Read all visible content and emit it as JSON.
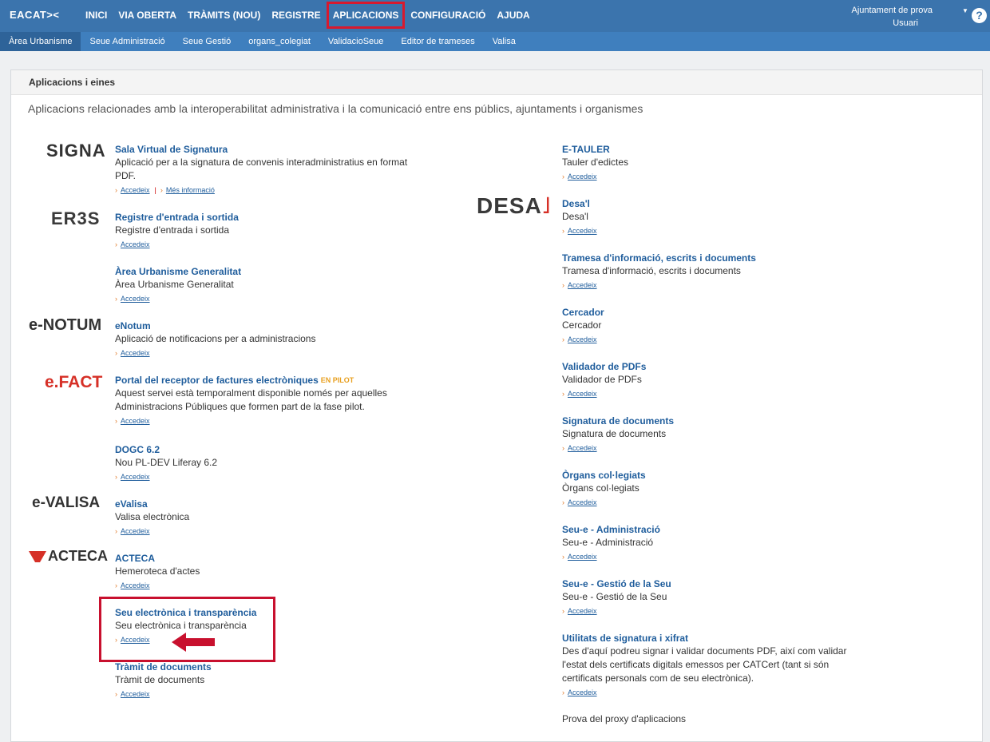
{
  "header": {
    "brand": "EACAT><",
    "nav": [
      "INICI",
      "VIA OBERTA",
      "TRÀMITS (NOU)",
      "REGISTRE",
      "APLICACIONS",
      "CONFIGURACIÓ",
      "AJUDA"
    ],
    "active_nav": "APLICACIONS",
    "org": "Ajuntament de prova",
    "user": "Usuari",
    "help": "?"
  },
  "subnav": [
    "Àrea Urbanisme",
    "Seue Administració",
    "Seue Gestió",
    "organs_colegiat",
    "ValidacioSeue",
    "Editor de trameses",
    "Valisa"
  ],
  "panel": {
    "title": "Aplicacions i eines",
    "intro": "Aplicacions relacionades amb la interoperabilitat administrativa i la comunicació entre ens públics, ajuntaments i organismes"
  },
  "links": {
    "access": "Accedeix",
    "more": "Més informació",
    "pilot": "EN PILOT"
  },
  "logos": {
    "signa": "SIGNA",
    "eres": "ER3S",
    "enotum": "e-NOTUM",
    "efact": "e.FACT",
    "evalisa": "e-VALISA",
    "acteca": "ACTECA",
    "desa": "DESA"
  },
  "apps_left": [
    {
      "title": "Sala Virtual de Signatura",
      "desc": "Aplicació per a la signatura de convenis interadministratius en format PDF."
    },
    {
      "title": "Registre d'entrada i sortida",
      "desc": "Registre d'entrada i sortida"
    },
    {
      "title": "Àrea Urbanisme Generalitat",
      "desc": "Àrea Urbanisme Generalitat"
    },
    {
      "title": "eNotum",
      "desc": "Aplicació de notificacions per a administracions"
    },
    {
      "title": "Portal del receptor de factures electròniques",
      "desc": "Aquest servei està temporalment disponible només per aquelles Administracions Públiques que formen part de la fase pilot."
    },
    {
      "title": "DOGC 6.2",
      "desc": "Nou PL-DEV Liferay 6.2"
    },
    {
      "title": "eValisa",
      "desc": "Valisa electrònica"
    },
    {
      "title": "ACTECA",
      "desc": "Hemeroteca d'actes"
    },
    {
      "title": "Seu electrònica i transparència",
      "desc": "Seu electrònica i transparència"
    },
    {
      "title": "Tràmit de documents",
      "desc": "Tràmit de documents"
    }
  ],
  "apps_right": [
    {
      "title": "E-TAULER",
      "desc": "Tauler d'edictes"
    },
    {
      "title": "Desa'l",
      "desc": "Desa'l"
    },
    {
      "title": "Tramesa d'informació, escrits i documents",
      "desc": "Tramesa d'informació, escrits i documents"
    },
    {
      "title": "Cercador",
      "desc": "Cercador"
    },
    {
      "title": "Validador de PDFs",
      "desc": "Validador de PDFs"
    },
    {
      "title": "Signatura de documents",
      "desc": "Signatura de documents"
    },
    {
      "title": "Òrgans col·legiats",
      "desc": "Òrgans col·legiats"
    },
    {
      "title": "Seu-e - Administració",
      "desc": "Seu-e - Administració"
    },
    {
      "title": "Seu-e - Gestió de la Seu",
      "desc": "Seu-e - Gestió de la Seu"
    },
    {
      "title": "Utilitats de signatura i xifrat",
      "desc": "Des d'aquí podreu signar i validar documents PDF, així com validar l'estat dels certificats digitals emessos per CATCert (tant si són certificats personals com de seu electrònica)."
    },
    {
      "title": "",
      "desc": "Prova del proxy d'aplicacions"
    }
  ],
  "colors": {
    "topbar": "#3b74ad",
    "subbar": "#3f7fbe",
    "link": "#1f5d9c",
    "highlight": "#c8102e",
    "accent": "#e07a2a"
  }
}
